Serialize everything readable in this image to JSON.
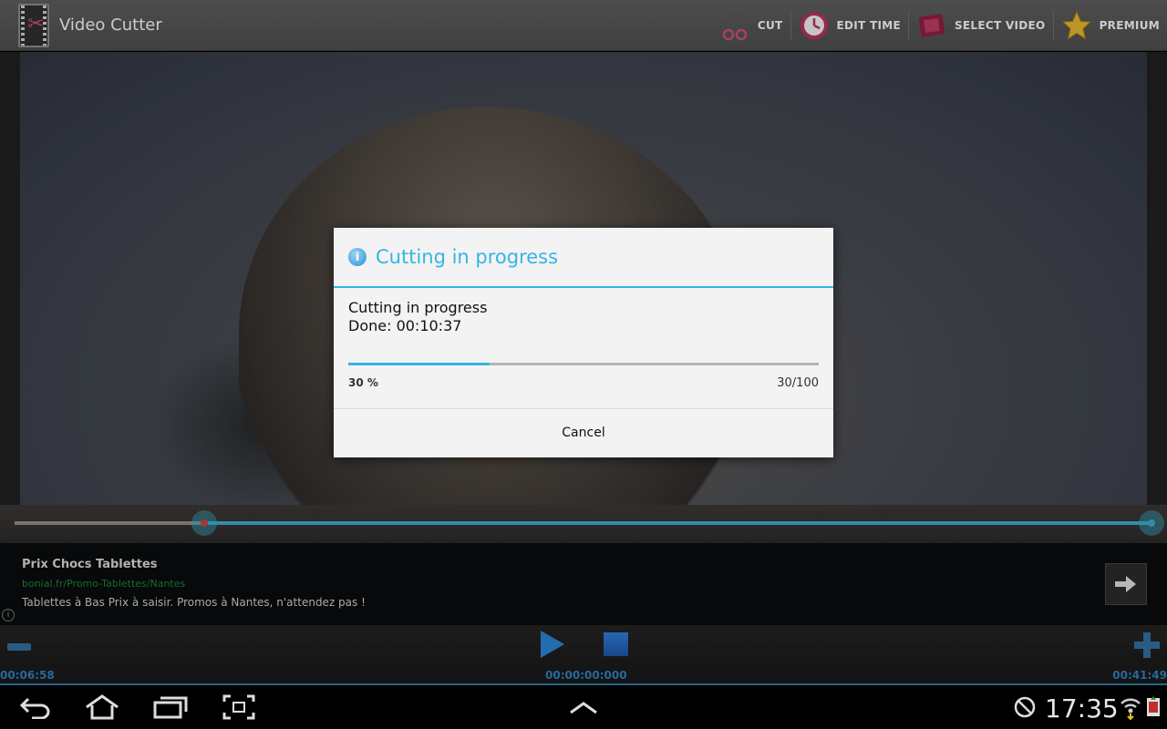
{
  "app": {
    "title": "Video Cutter",
    "icon": "film-scissors-icon"
  },
  "actions": [
    {
      "label": "CUT",
      "icon": "scissors-icon"
    },
    {
      "label": "EDIT TIME",
      "icon": "clock-icon"
    },
    {
      "label": "SELECT VIDEO",
      "icon": "film-icon"
    },
    {
      "label": "PREMIUM",
      "icon": "star-icon"
    }
  ],
  "dialog": {
    "title": "Cutting in progress",
    "message_line1": "Cutting in progress",
    "message_line2": "Done: 00:10:37",
    "progress_percent": 30,
    "percent_label": "30 %",
    "count_label": "30/100",
    "cancel_label": "Cancel"
  },
  "ad": {
    "title": "Prix Chocs Tablettes",
    "url": "bonial.fr/Promo-Tablettes/Nantes",
    "text": "Tablettes à Bas Prix à saisir. Promos à Nantes, n'attendez pas !",
    "info": "i"
  },
  "player": {
    "time_start": "00:06:58",
    "time_current": "00:00:00:000",
    "time_end": "00:41:49"
  },
  "status": {
    "clock": "17:35"
  },
  "colors": {
    "accent": "#33b5e5",
    "timeline": "#3aa7c8",
    "control": "#2f7bb8"
  }
}
